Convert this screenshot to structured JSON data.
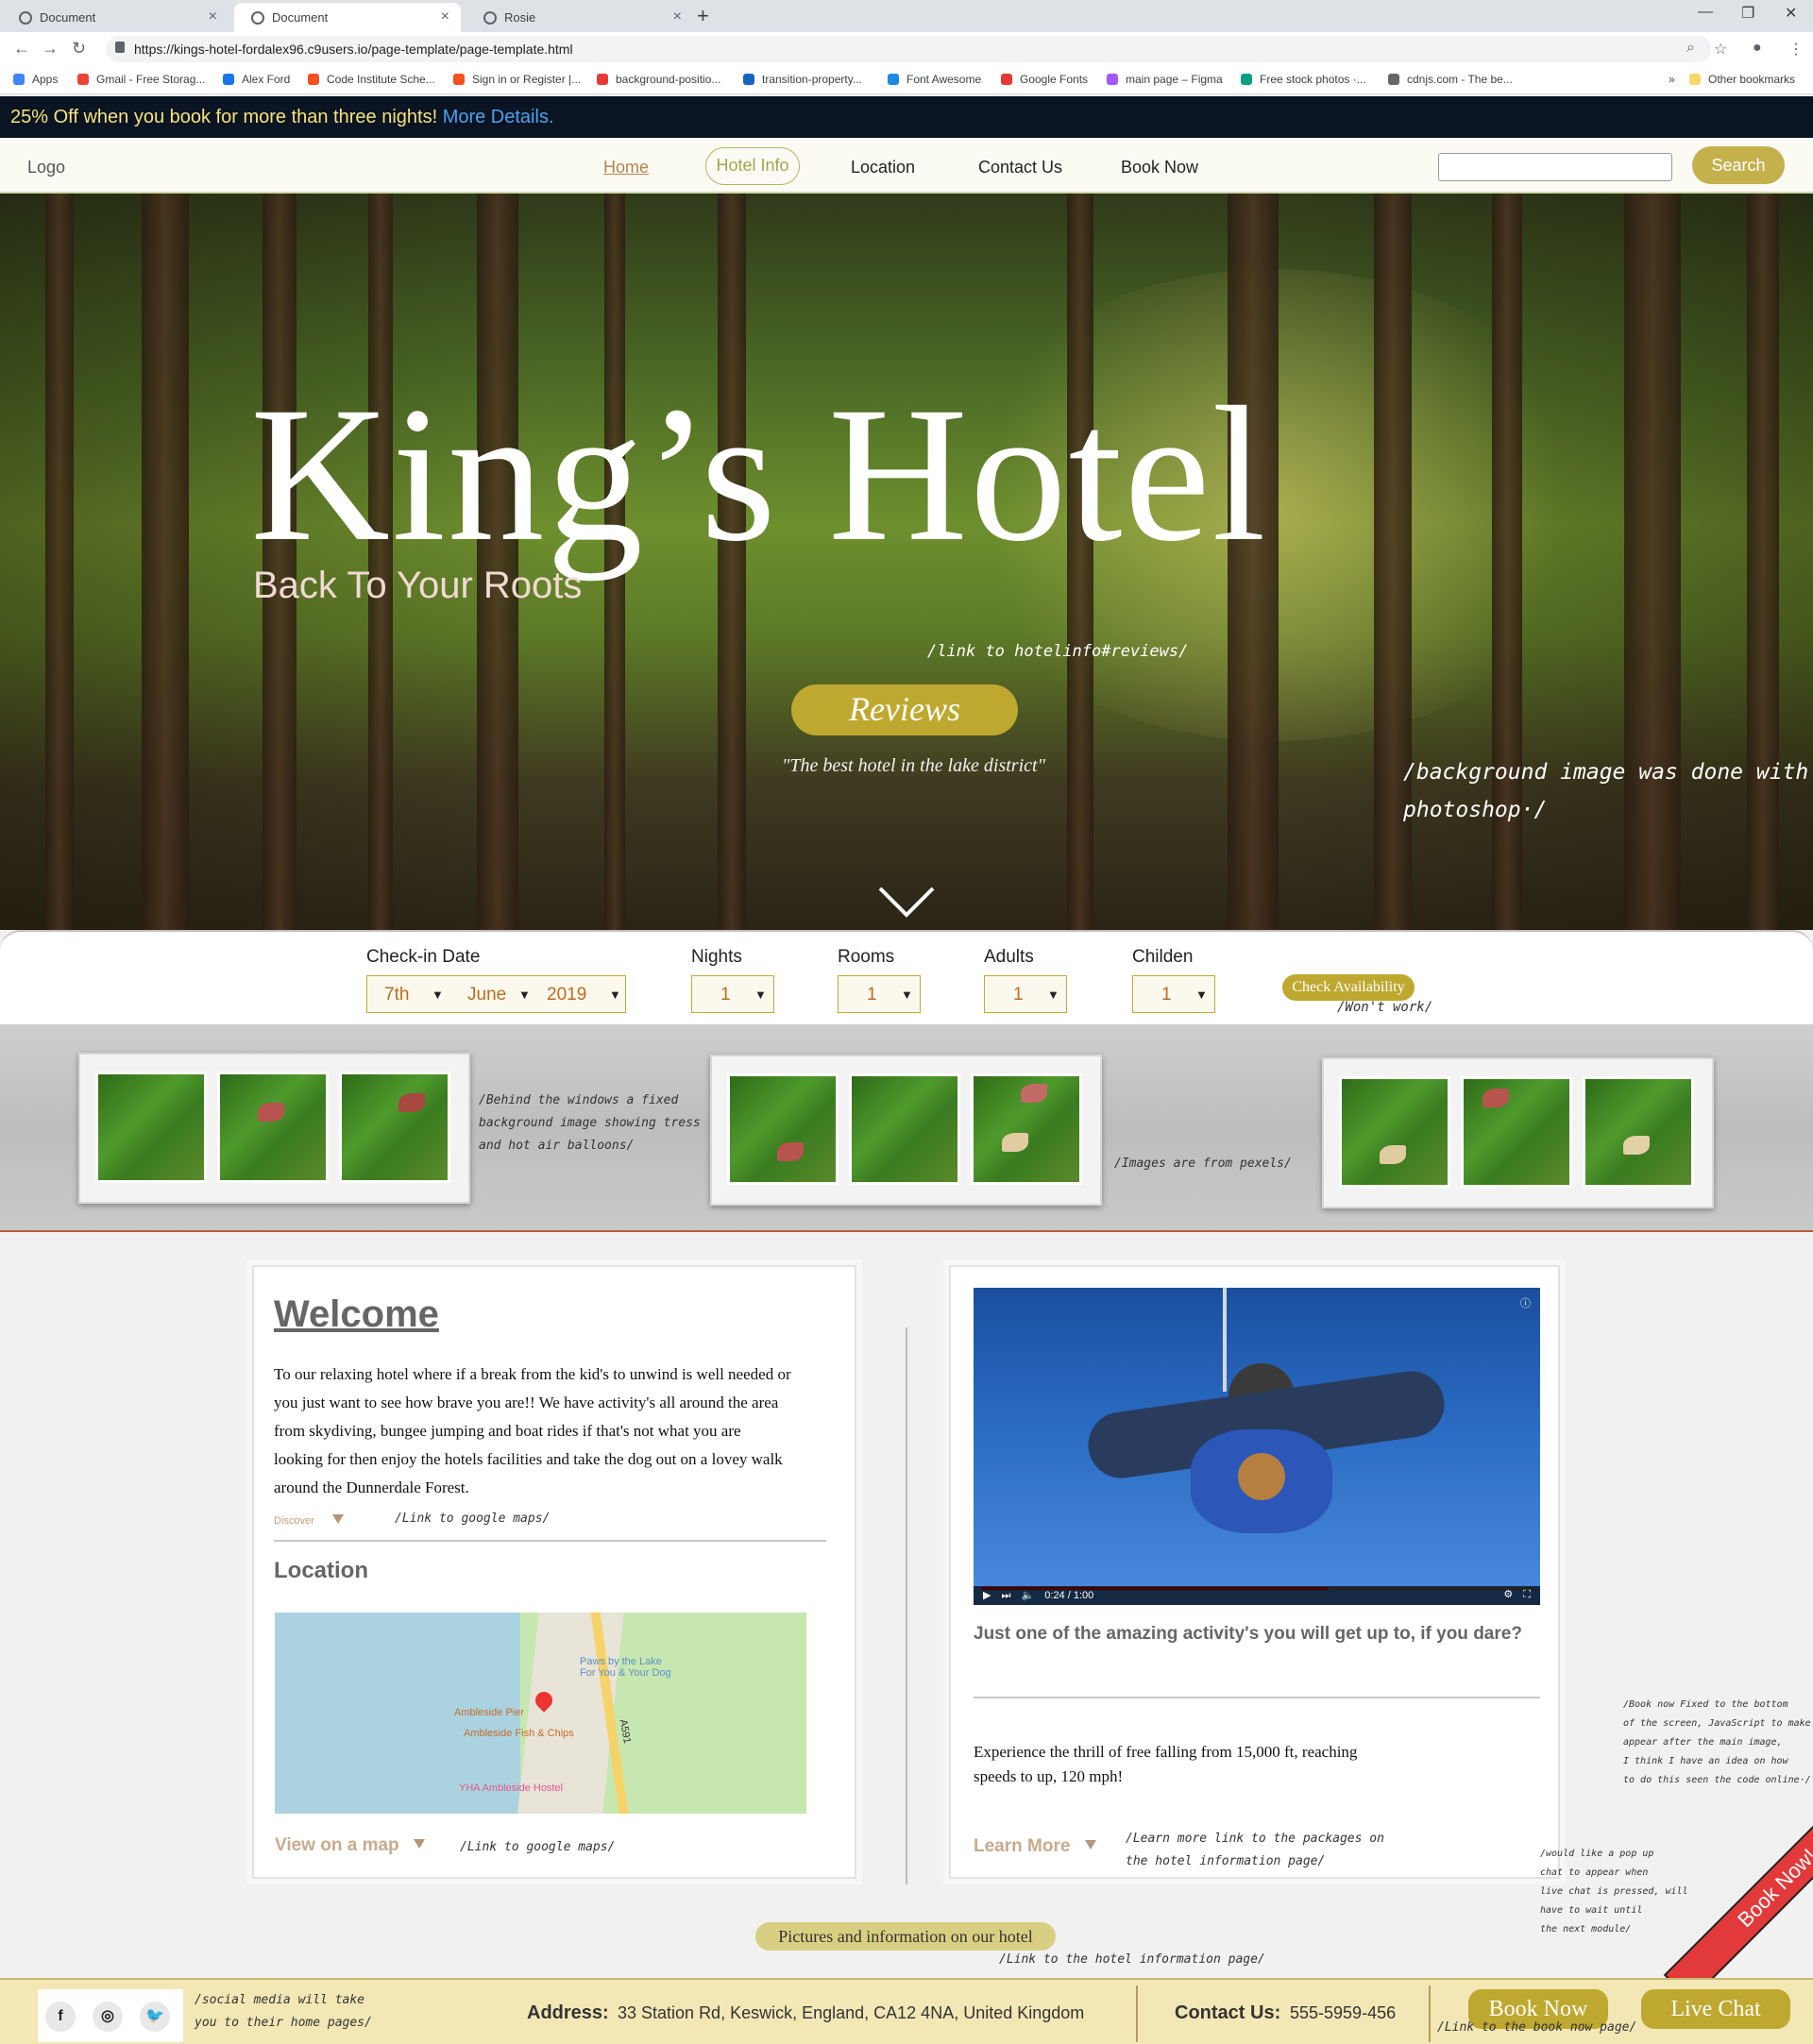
{
  "browser": {
    "tabs": [
      {
        "title": "Document",
        "active": false
      },
      {
        "title": "Document",
        "active": true
      },
      {
        "title": "Rosie",
        "active": false
      }
    ],
    "url": "https://kings-hotel-fordalex96.c9users.io/page-template/page-template.html",
    "bookmarks": [
      {
        "label": "Apps",
        "color": "#4285f4"
      },
      {
        "label": "Gmail - Free Storag...",
        "color": "#ea4335"
      },
      {
        "label": "Alex Ford",
        "color": "#1a73e8"
      },
      {
        "label": "Code Institute Sche...",
        "color": "#f4511e"
      },
      {
        "label": "Sign in or Register |...",
        "color": "#f4511e"
      },
      {
        "label": "background-positio...",
        "color": "#e53935"
      },
      {
        "label": "transition-property...",
        "color": "#1565c0"
      },
      {
        "label": "Font Awesome",
        "color": "#1e88e5"
      },
      {
        "label": "Google Fonts",
        "color": "#e53935"
      },
      {
        "label": "main page – Figma",
        "color": "#a259ff"
      },
      {
        "label": "Free stock photos ·...",
        "color": "#05a081"
      },
      {
        "label": "cdnjs.com - The be...",
        "color": "#666666"
      }
    ],
    "other_bookmarks": "Other bookmarks"
  },
  "promo": {
    "text": "25% Off when you book for more than three nights!",
    "link": "More Details."
  },
  "nav": {
    "logo": "Logo",
    "items": [
      "Home",
      "Hotel Info",
      "Location",
      "Contact Us",
      "Book Now"
    ],
    "search_label": "Search",
    "search_value": ""
  },
  "hero": {
    "title": "King’s Hotel",
    "subtitle": "Back To Your Roots",
    "annotation_reviews": "/link to hotelinfo#reviews/",
    "reviews_button": "Reviews",
    "quote": "\"The best hotel in the lake district\"",
    "annotation_bg_1": "/background image was done with",
    "annotation_bg_2": "photoshop·/"
  },
  "booking": {
    "checkin_label": "Check-in Date",
    "day": "7th",
    "month": "June",
    "year": "2019",
    "nights_label": "Nights",
    "nights": "1",
    "rooms_label": "Rooms",
    "rooms": "1",
    "adults_label": "Adults",
    "adults": "1",
    "children_label": "Childen",
    "children": "1",
    "check_button": "Check Availability",
    "annotation": "/Won't work/"
  },
  "windows": {
    "annotation_1a": "/Behind the windows a fixed",
    "annotation_1b": "background image showing tress",
    "annotation_1c": "and hot air balloons/",
    "annotation_2": "/Images are from pexels/"
  },
  "welcome": {
    "heading": "Welcome",
    "body": "To our relaxing hotel where if a break from the kid's to unwind is well needed or you just want to see how brave you are!! We have activity's all around the area from skydiving, bungee jumping and boat rides if that's not what you are looking for then enjoy the hotels facilities and take the dog out on a lovey walk around the Dunnerdale Forest.",
    "discover": "Discover",
    "annotation_discover": "/Link to google maps/",
    "location_heading": "Location",
    "map_labels": [
      "Paws by the Lake",
      "For You & Your Dog",
      "Ambleside Pier",
      "Ambleside Fish & Chips",
      "A591",
      "YHA Ambleside Hostel"
    ],
    "view_map": "View on a map",
    "annotation_map": "/Link to google maps/"
  },
  "activity": {
    "heading": "Just one of the amazing activity's you will get up to, if you dare?",
    "body": "Experience the thrill of free falling from 15,000 ft, reaching speeds to up, 120 mph!",
    "learn_more": "Learn More",
    "annotation_learn_1": "/Learn more link to the packages on",
    "annotation_learn_2": "the hotel information page/",
    "video_time": "0:24 / 1:00",
    "video_progress": 0.63
  },
  "side_notes": {
    "book_now_note": [
      "/Book now Fixed to the bottom",
      "of the screen, JavaScript to make",
      "appear after the main image,",
      "I think I have an idea on how",
      "to do this seen the code online·/"
    ],
    "chat_note": [
      "/would like a pop up",
      "chat to appear when",
      "live chat is pressed, will",
      "have to wait until",
      "the next module/"
    ],
    "ribbon": "Book Now!"
  },
  "pictures": {
    "button": "Pictures and information on our hotel",
    "annotation": "/Link to the hotel information page/"
  },
  "footer": {
    "social_annotation_1": "/social media will take",
    "social_annotation_2": "you to their home pages/",
    "address_label": "Address:",
    "address": "33 Station Rd, Keswick, England, CA12 4NA, United Kingdom",
    "contact_label": "Contact Us:",
    "phone": "555-5959-456",
    "book_now": "Book Now",
    "live_chat": "Live Chat",
    "annotation_book": "/Link to the book now page/"
  }
}
